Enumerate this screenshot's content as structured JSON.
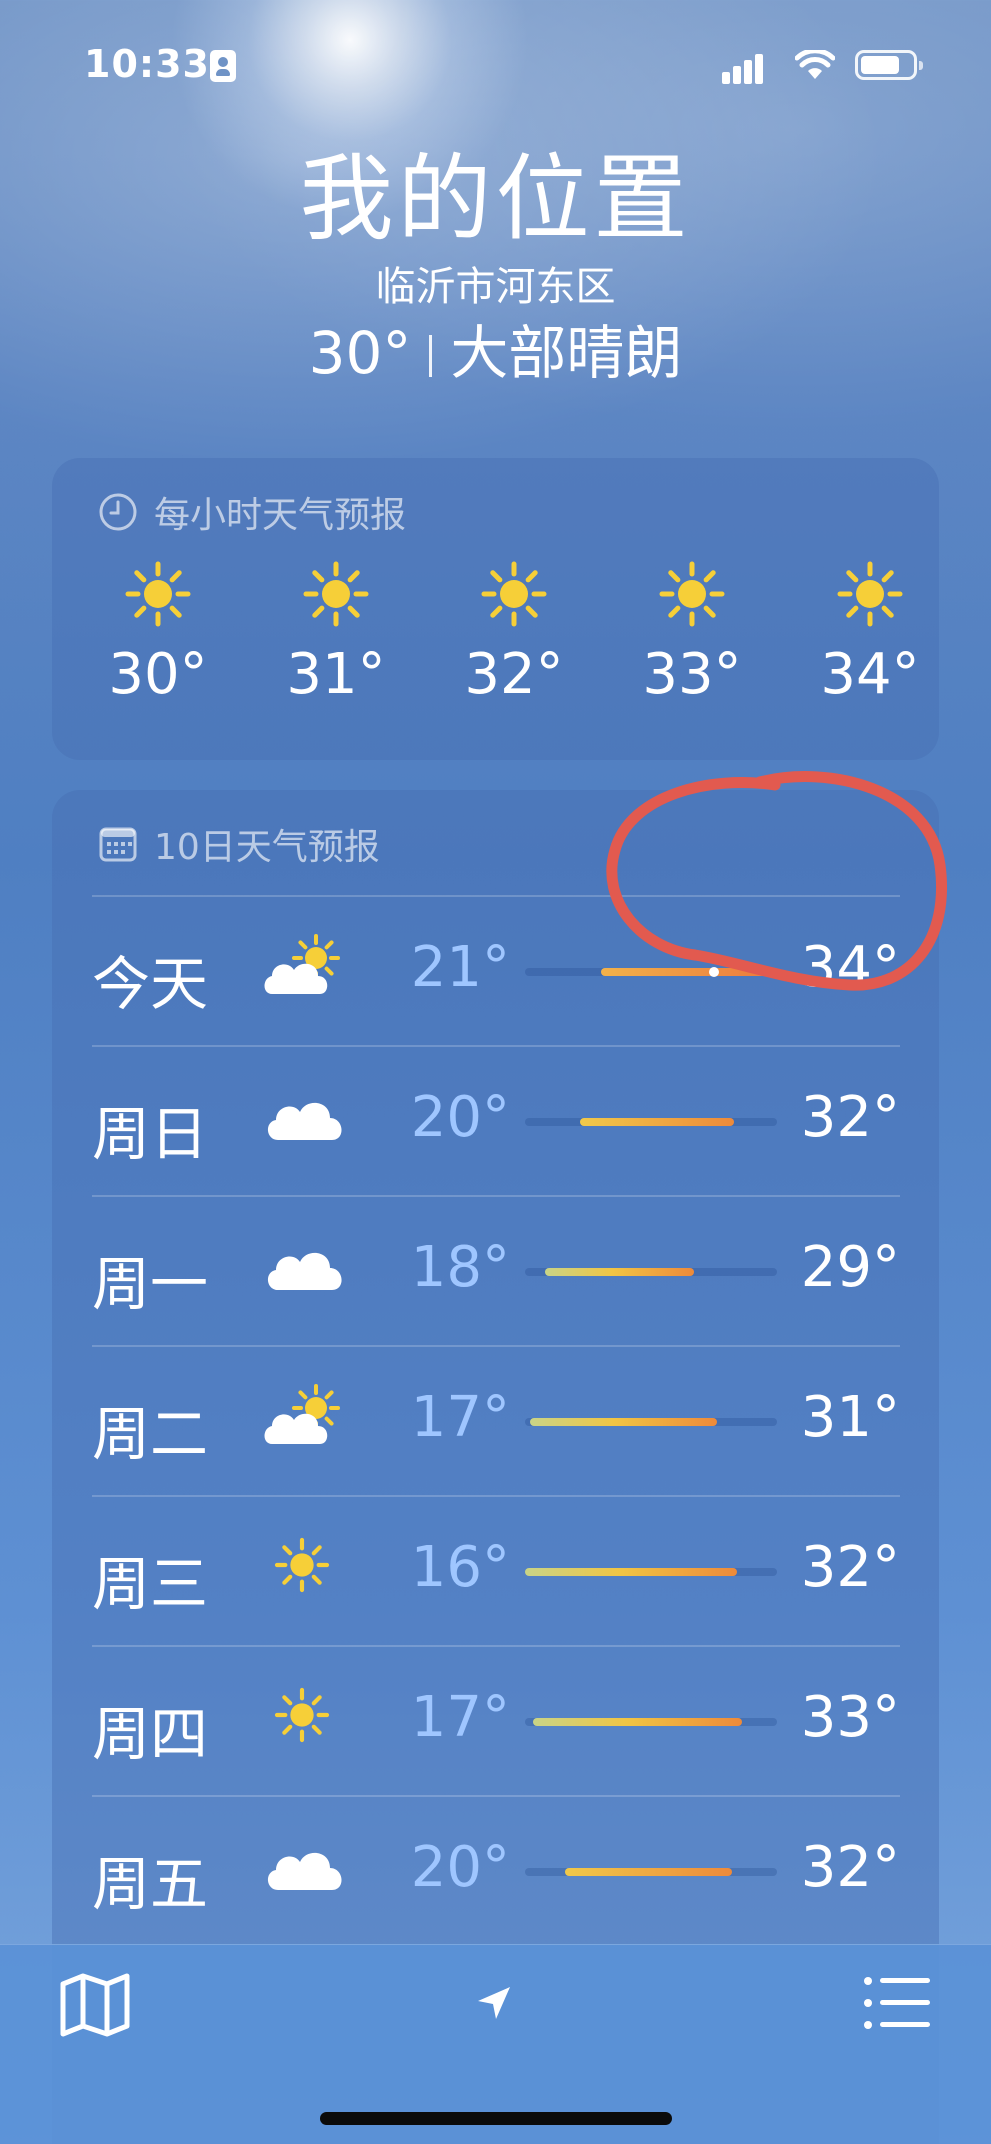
{
  "status_bar": {
    "time": "10:33",
    "icons": [
      "contact-card-icon",
      "cellular-signal-icon",
      "wifi-icon",
      "battery-icon"
    ]
  },
  "header": {
    "title": "我的位置",
    "subtitle": "临沂市河东区",
    "current_temp": "30°",
    "condition": "大部晴朗"
  },
  "hourly": {
    "title": "每小时天气预报",
    "icon": "clock-icon",
    "items": [
      {
        "icon": "sun-icon",
        "temp": "30°"
      },
      {
        "icon": "sun-icon",
        "temp": "31°"
      },
      {
        "icon": "sun-icon",
        "temp": "32°"
      },
      {
        "icon": "sun-icon",
        "temp": "33°"
      },
      {
        "icon": "sun-icon",
        "temp": "34°"
      }
    ]
  },
  "daily": {
    "title": "10日天气预报",
    "icon": "calendar-icon",
    "items": [
      {
        "day": "今天",
        "icon": "partly-cloudy-icon",
        "low": "21°",
        "high": "34°",
        "range": [
          0.3,
          0.98
        ],
        "current": 0.75
      },
      {
        "day": "周日",
        "icon": "cloud-icon",
        "low": "20°",
        "high": "32°",
        "range": [
          0.22,
          0.83
        ]
      },
      {
        "day": "周一",
        "icon": "cloud-icon",
        "low": "18°",
        "high": "29°",
        "range": [
          0.08,
          0.67
        ]
      },
      {
        "day": "周二",
        "icon": "partly-cloudy-icon",
        "low": "17°",
        "high": "31°",
        "range": [
          0.02,
          0.76
        ]
      },
      {
        "day": "周三",
        "icon": "sun-icon",
        "low": "16°",
        "high": "32°",
        "range": [
          0.0,
          0.84
        ]
      },
      {
        "day": "周四",
        "icon": "sun-icon",
        "low": "17°",
        "high": "33°",
        "range": [
          0.03,
          0.86
        ]
      },
      {
        "day": "周五",
        "icon": "cloud-icon",
        "low": "20°",
        "high": "32°",
        "range": [
          0.16,
          0.82
        ]
      }
    ]
  },
  "tabbar": {
    "icons": [
      "map-icon",
      "location-arrow-icon",
      "list-icon"
    ]
  },
  "annotation": {
    "color": "#e25a4f",
    "shape": "hand-drawn circle"
  }
}
